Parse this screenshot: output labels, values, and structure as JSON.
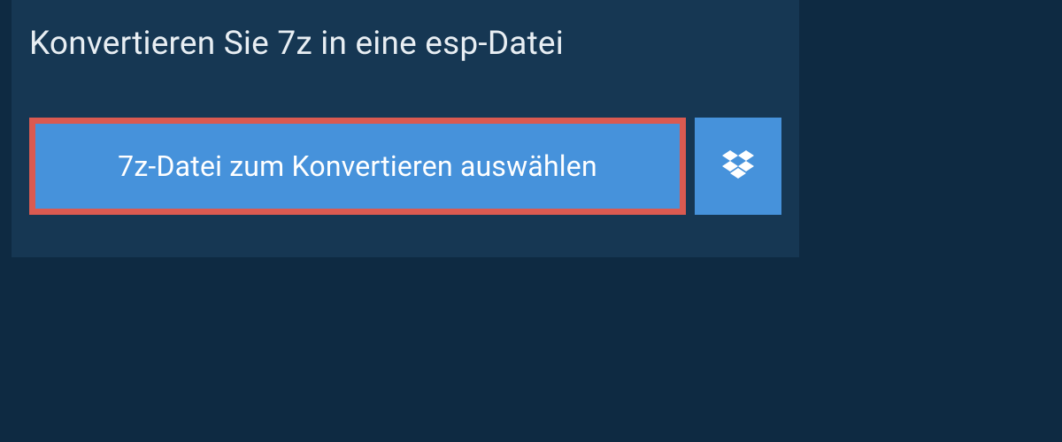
{
  "header": {
    "title": "Konvertieren Sie 7z in eine esp-Datei"
  },
  "actions": {
    "select_file_label": "7z-Datei zum Konvertieren auswählen"
  },
  "colors": {
    "page_bg": "#0e2a42",
    "panel_bg": "#163753",
    "button_bg": "#4692db",
    "highlight_border": "#da5a51",
    "text": "#ffffff"
  }
}
